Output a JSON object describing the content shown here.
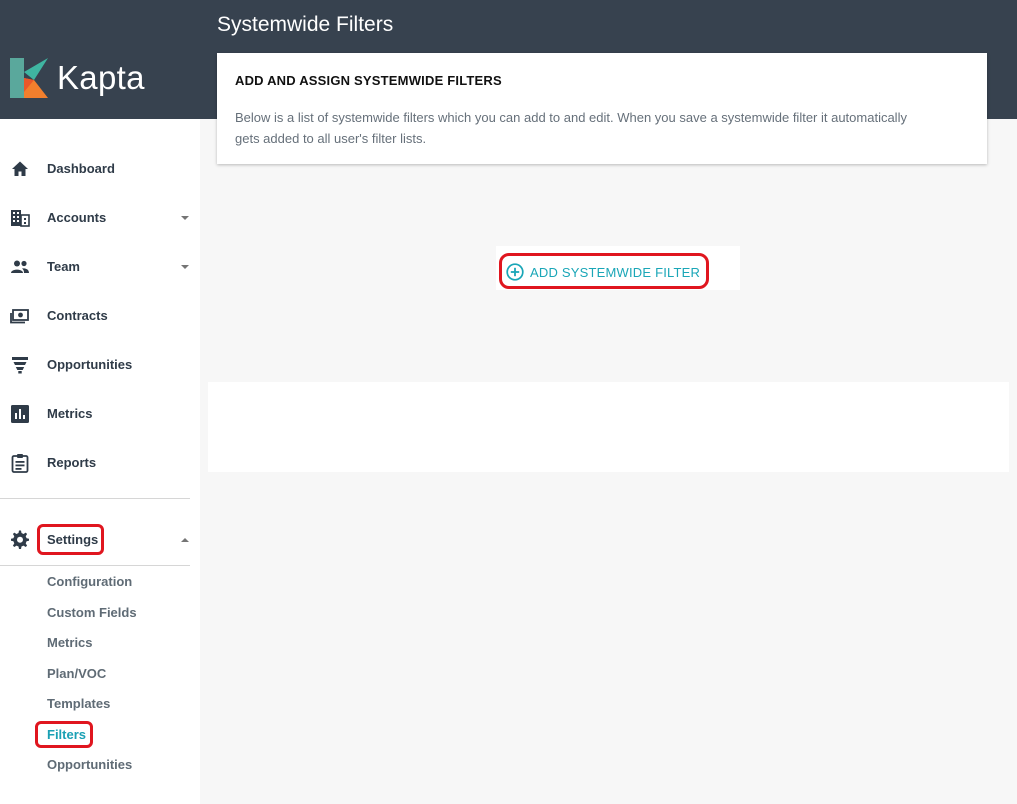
{
  "app": {
    "name": "Kapta",
    "page_title": "Systemwide Filters"
  },
  "sidebar": {
    "items": [
      {
        "label": "Dashboard",
        "icon": "home-icon"
      },
      {
        "label": "Accounts",
        "icon": "building-icon"
      },
      {
        "label": "Team",
        "icon": "people-icon"
      },
      {
        "label": "Contracts",
        "icon": "money-icon"
      },
      {
        "label": "Opportunities",
        "icon": "funnel-icon"
      },
      {
        "label": "Metrics",
        "icon": "bar-chart-icon"
      },
      {
        "label": "Reports",
        "icon": "clipboard-icon"
      }
    ],
    "settings": {
      "label": "Settings",
      "icon": "gear-icon",
      "sub_items": [
        "Configuration",
        "Custom Fields",
        "Metrics",
        "Plan/VOC",
        "Templates",
        "Filters",
        "Opportunities"
      ],
      "active_sub_item": "Filters"
    }
  },
  "card": {
    "title": "ADD AND ASSIGN SYSTEMWIDE FILTERS",
    "description": "Below is a list of systemwide filters which you can add to and edit. When you save a systemwide filter it automatically gets added to all user's filter lists."
  },
  "actions": {
    "add_label": "ADD SYSTEMWIDE FILTER",
    "add_icon": "plus-circle-icon"
  },
  "colors": {
    "header_bg": "#37424f",
    "accent": "#1aa6b7",
    "annotation": "#e0161f",
    "logo_green": "#3fb5a1",
    "logo_orange": "#f27f2d"
  }
}
